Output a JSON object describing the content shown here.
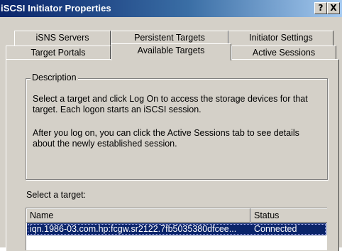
{
  "window": {
    "title": "iSCSI Initiator Properties",
    "help_button": "?",
    "close_button": "X"
  },
  "tabs": {
    "row1": [
      {
        "label": "iSNS Servers"
      },
      {
        "label": "Persistent Targets"
      },
      {
        "label": "Initiator Settings"
      }
    ],
    "row2": [
      {
        "label": "Target Portals"
      },
      {
        "label": "Available Targets",
        "active": true
      },
      {
        "label": "Active Sessions"
      }
    ]
  },
  "description": {
    "legend": "Description",
    "paragraph1": "Select a target and click Log On to access the storage devices for that target. Each logon starts an iSCSI session.",
    "paragraph2": "After you log on, you can click the Active Sessions tab to see details about the newly established session."
  },
  "targets": {
    "label": "Select a target:",
    "columns": [
      "Name",
      "Status"
    ],
    "rows": [
      {
        "name": "iqn.1986-03.com.hp:fcgw.sr2122.7fb5035380dfcee...",
        "status": "Connected",
        "selected": true
      }
    ]
  },
  "colors": {
    "title_gradient_start": "#0a246a",
    "title_gradient_end": "#a6caf0",
    "selection": "#0a246a",
    "face": "#d4d0c8"
  }
}
